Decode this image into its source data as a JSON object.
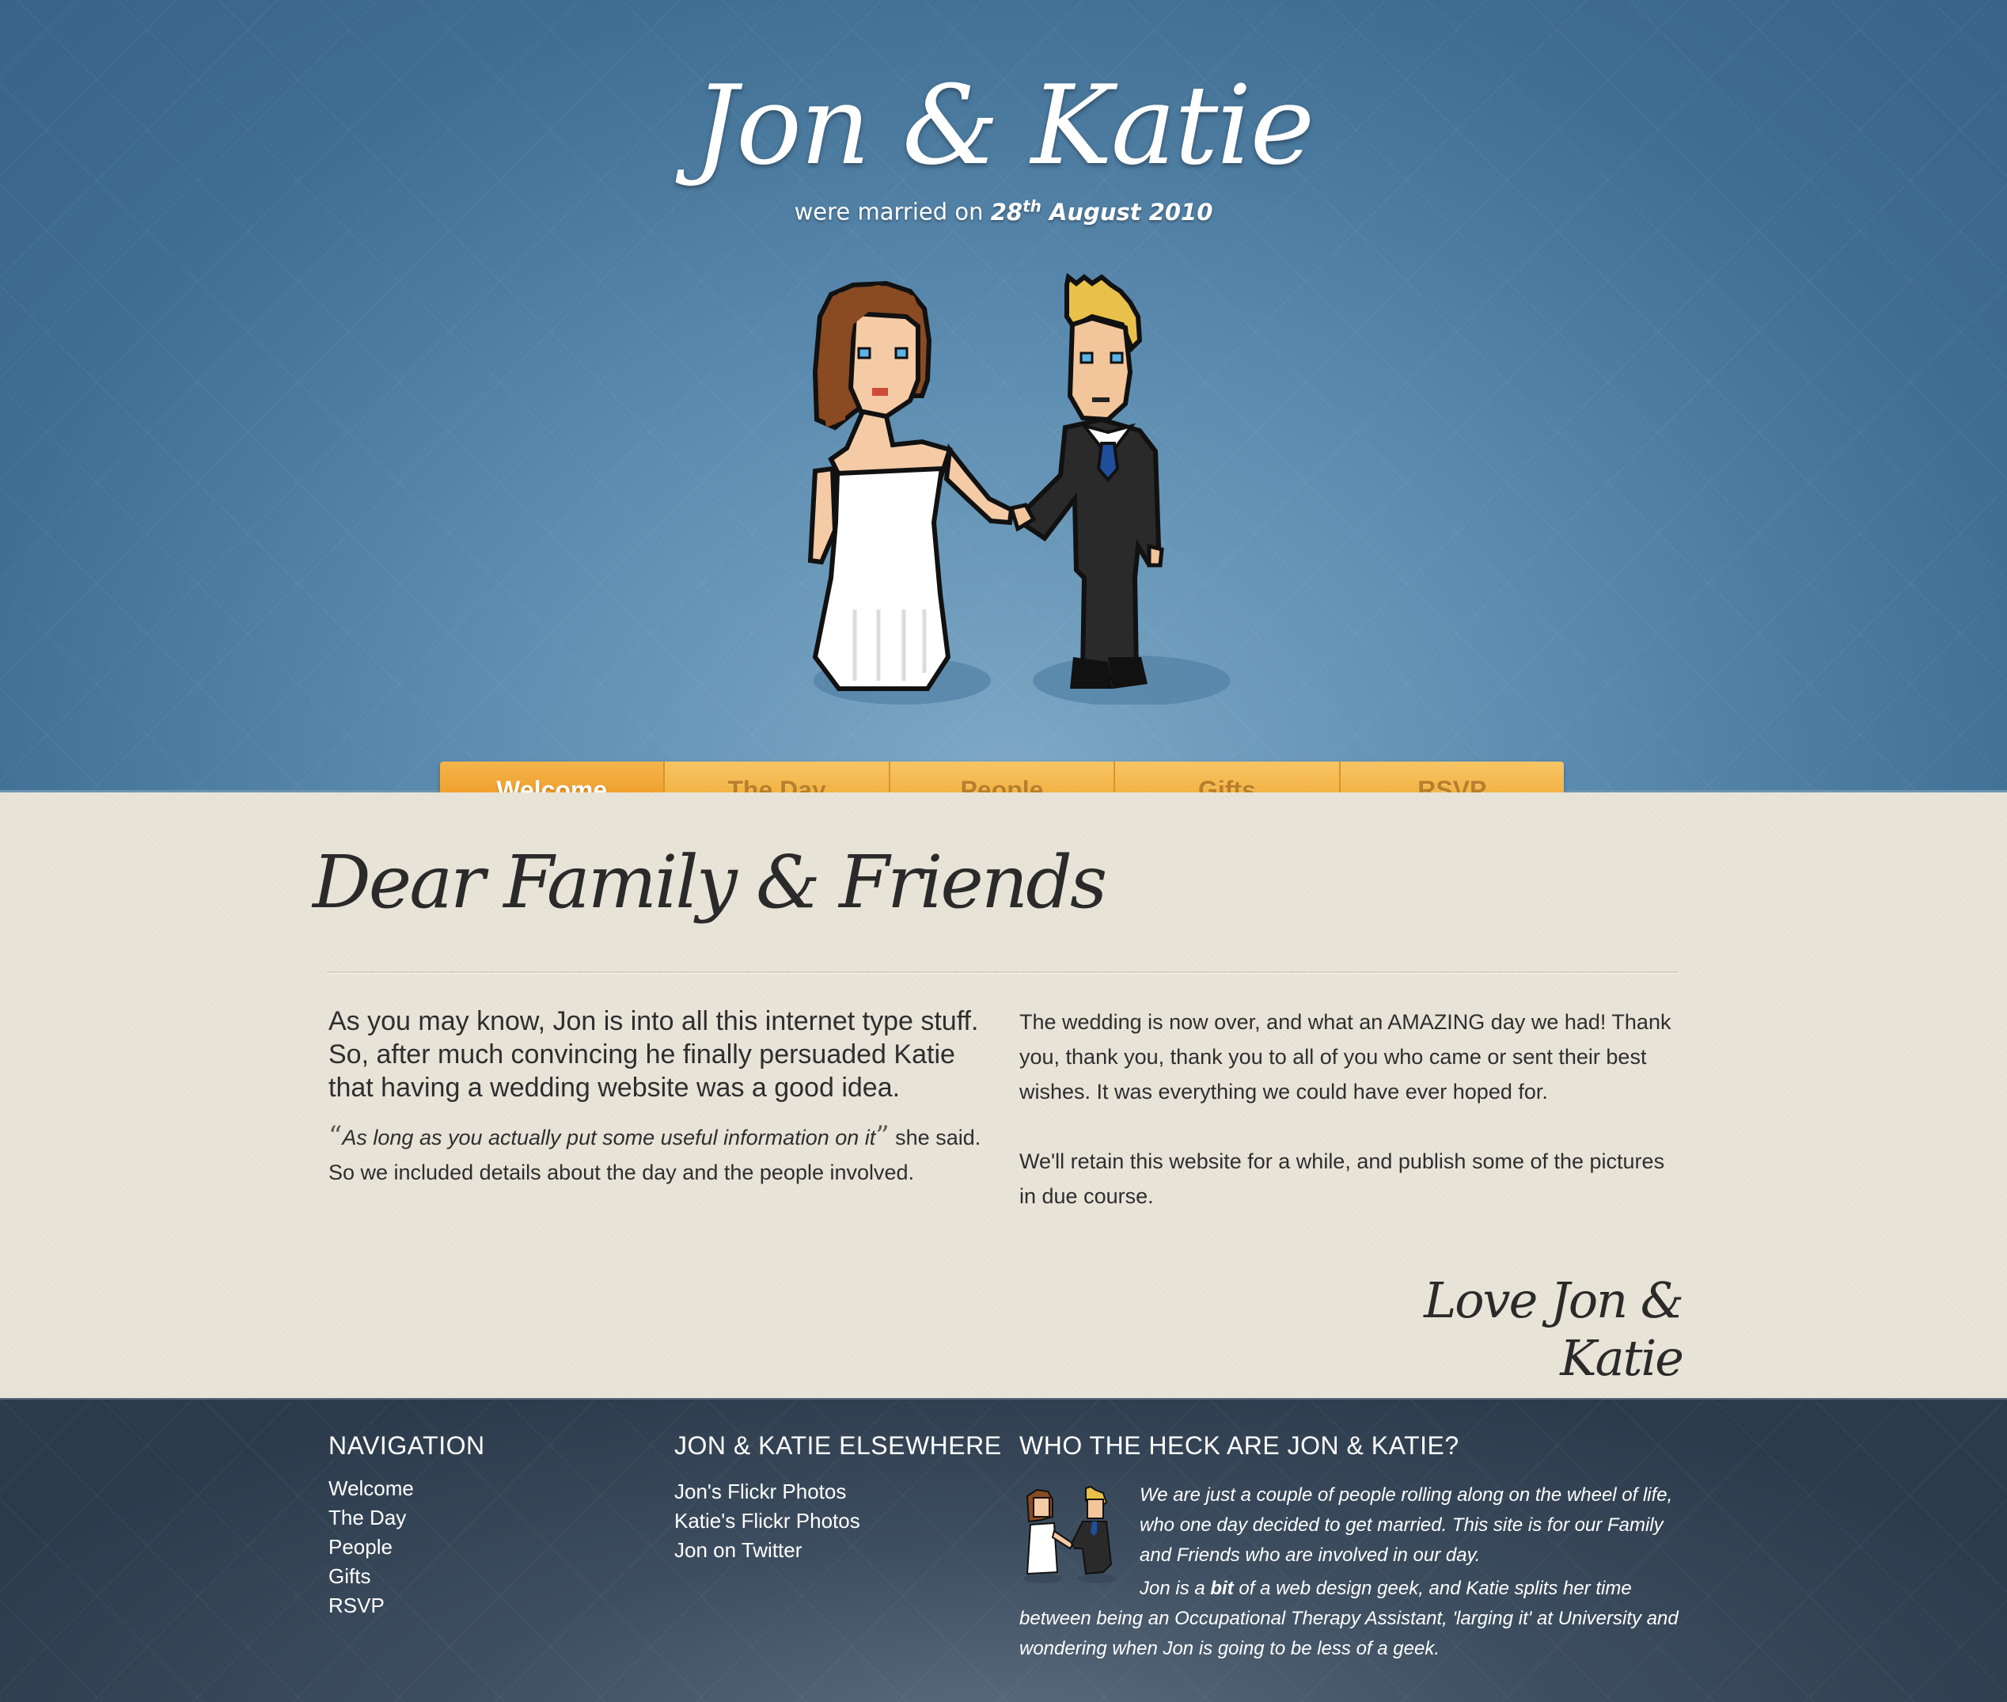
{
  "header": {
    "title": "Jon & Katie",
    "subtitle_prefix": "were married on",
    "date_day": "28",
    "date_suffix": "th",
    "date_rest": "August 2010"
  },
  "nav": {
    "tabs": [
      {
        "label": "Welcome",
        "active": true
      },
      {
        "label": "The Day",
        "active": false
      },
      {
        "label": "People",
        "active": false
      },
      {
        "label": "Gifts",
        "active": false
      },
      {
        "label": "RSVP",
        "active": false
      }
    ]
  },
  "main": {
    "heading": "Dear Family & Friends",
    "left": {
      "lead": "As you may know, Jon is into all this internet type stuff. So, after much convincing he finally persuaded Katie that having a wedding website was a good idea.",
      "quote_open": "“",
      "quote": "As long as you actually put some useful information on it",
      "quote_close": "”",
      "quote_after": " she said. So we included details about the day and the people involved."
    },
    "right": {
      "p1": "The wedding is now over, and what an AMAZING day we had! Thank you, thank you, thank you to all of you who came or sent their best wishes. It was everything we could have ever hoped for.",
      "p2": "We'll retain this website for a while, and publish some of the pictures in due course."
    },
    "sign_off": "Love Jon & Katie"
  },
  "footer": {
    "navigation": {
      "heading": "Navigation",
      "items": [
        "Welcome",
        "The Day",
        "People",
        "Gifts",
        "RSVP"
      ]
    },
    "elsewhere": {
      "heading": "Jon & Katie Elsewhere",
      "items": [
        "Jon's Flickr Photos",
        "Katie's Flickr Photos",
        "Jon on Twitter"
      ]
    },
    "who": {
      "heading": "Who the heck are Jon & Katie?",
      "p1": "We are just a couple of people rolling along on the wheel of life, who one day decided to get married. This site is for our Family and Friends who are involved in our day.",
      "p2_before": "Jon is a ",
      "p2_bold": "bit",
      "p2_after": " of a web design geek, and Katie splits her time between being an Occupational Therapy Assistant, 'larging it' at University and wondering when Jon is going to be less of a geek."
    }
  },
  "colors": {
    "header_blue": "#3f6d93",
    "nav_orange": "#f3b345",
    "paper": "#e8e4d8",
    "footer_slate": "#2c3b4c"
  },
  "icons": {
    "couple_illustration": "pixel-art-bride-and-groom",
    "mini_couple": "pixel-art-bride-and-groom-small"
  }
}
